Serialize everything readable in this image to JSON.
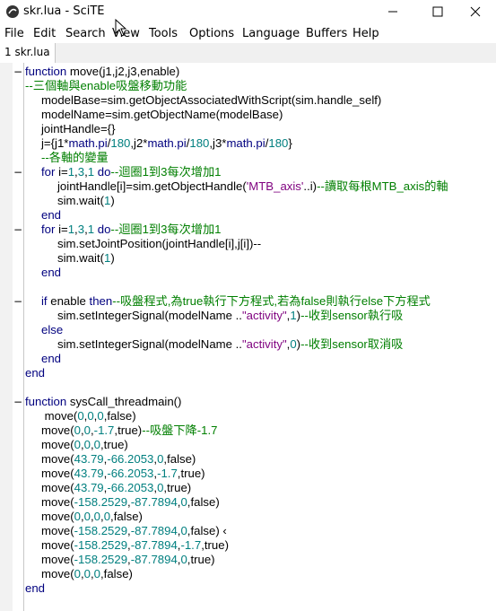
{
  "window": {
    "title": "skr.lua - SciTE"
  },
  "menu": [
    "File",
    "Edit",
    "Search",
    "View",
    "Tools",
    "Options",
    "Language",
    "Buffers",
    "Help"
  ],
  "tab": {
    "label": "1 skr.lua"
  },
  "code_lines": [
    {
      "fold": "−",
      "indent": 0,
      "t": [
        [
          "kw",
          "function "
        ],
        [
          "id",
          "move(j1,j2,j3,enable)"
        ]
      ]
    },
    {
      "fold": "",
      "indent": 0,
      "t": [
        [
          "cm",
          "--三個軸與enable吸盤移動功能"
        ]
      ]
    },
    {
      "fold": "",
      "indent": 1,
      "t": [
        [
          "id",
          "modelBase=sim.getObjectAssociatedWithScript(sim.handle_self)"
        ]
      ]
    },
    {
      "fold": "",
      "indent": 1,
      "t": [
        [
          "id",
          "modelName=sim.getObjectName(modelBase)"
        ]
      ]
    },
    {
      "fold": "",
      "indent": 1,
      "t": [
        [
          "id",
          "jointHandle={}"
        ]
      ]
    },
    {
      "fold": "",
      "indent": 1,
      "t": [
        [
          "id",
          "j={j1*"
        ],
        [
          "kw",
          "math.pi"
        ],
        [
          "id",
          "/"
        ],
        [
          "num",
          "180"
        ],
        [
          "id",
          ",j2*"
        ],
        [
          "kw",
          "math.pi"
        ],
        [
          "id",
          "/"
        ],
        [
          "num",
          "180"
        ],
        [
          "id",
          ",j3*"
        ],
        [
          "kw",
          "math.pi"
        ],
        [
          "id",
          "/"
        ],
        [
          "num",
          "180"
        ],
        [
          "id",
          "}"
        ]
      ]
    },
    {
      "fold": "",
      "indent": 1,
      "t": [
        [
          "cm",
          "--各軸的變量"
        ]
      ]
    },
    {
      "fold": "−",
      "indent": 1,
      "t": [
        [
          "kw",
          "for "
        ],
        [
          "id",
          "i="
        ],
        [
          "num",
          "1"
        ],
        [
          "id",
          ","
        ],
        [
          "num",
          "3"
        ],
        [
          "id",
          ","
        ],
        [
          "num",
          "1"
        ],
        [
          "kw",
          " do"
        ],
        [
          "cm",
          "--迴圈1到3每次增加1"
        ]
      ]
    },
    {
      "fold": "",
      "indent": 2,
      "t": [
        [
          "id",
          "jointHandle[i]=sim.getObjectHandle("
        ],
        [
          "str",
          "'MTB_axis'"
        ],
        [
          "id",
          "..i)"
        ],
        [
          "cm",
          "--讀取每根MTB_axis的軸"
        ]
      ]
    },
    {
      "fold": "",
      "indent": 2,
      "t": [
        [
          "id",
          "sim.wait("
        ],
        [
          "num",
          "1"
        ],
        [
          "id",
          ")"
        ]
      ]
    },
    {
      "fold": "",
      "indent": 1,
      "t": [
        [
          "kw",
          "end"
        ]
      ]
    },
    {
      "fold": "−",
      "indent": 1,
      "t": [
        [
          "kw",
          "for "
        ],
        [
          "id",
          "i="
        ],
        [
          "num",
          "1"
        ],
        [
          "id",
          ","
        ],
        [
          "num",
          "3"
        ],
        [
          "id",
          ","
        ],
        [
          "num",
          "1"
        ],
        [
          "kw",
          " do"
        ],
        [
          "cm",
          "--迴圈1到3每次增加1"
        ]
      ]
    },
    {
      "fold": "",
      "indent": 2,
      "t": [
        [
          "id",
          "sim.setJointPosition(jointHandle[i],j[i])--"
        ]
      ]
    },
    {
      "fold": "",
      "indent": 2,
      "t": [
        [
          "id",
          "sim.wait("
        ],
        [
          "num",
          "1"
        ],
        [
          "id",
          ")"
        ]
      ]
    },
    {
      "fold": "",
      "indent": 1,
      "t": [
        [
          "kw",
          "end"
        ]
      ]
    },
    {
      "fold": "",
      "indent": 0,
      "t": []
    },
    {
      "fold": "−",
      "indent": 1,
      "t": [
        [
          "kw",
          "if "
        ],
        [
          "id",
          "enable "
        ],
        [
          "kw",
          "then"
        ],
        [
          "cm",
          "--吸盤程式,為true執行下方程式,若為false則執行else下方程式"
        ]
      ]
    },
    {
      "fold": "",
      "indent": 2,
      "t": [
        [
          "id",
          "sim.setIntegerSignal(modelName .."
        ],
        [
          "str",
          "\"activity\""
        ],
        [
          "id",
          ","
        ],
        [
          "num",
          "1"
        ],
        [
          "id",
          ")"
        ],
        [
          "cm",
          "--收到sensor執行吸"
        ]
      ]
    },
    {
      "fold": "",
      "indent": 1,
      "t": [
        [
          "kw",
          "else"
        ]
      ]
    },
    {
      "fold": "",
      "indent": 2,
      "t": [
        [
          "id",
          "sim.setIntegerSignal(modelName .."
        ],
        [
          "str",
          "\"activity\""
        ],
        [
          "id",
          ","
        ],
        [
          "num",
          "0"
        ],
        [
          "id",
          ")"
        ],
        [
          "cm",
          "--收到sensor取消吸"
        ]
      ]
    },
    {
      "fold": "",
      "indent": 1,
      "t": [
        [
          "kw",
          "end"
        ]
      ]
    },
    {
      "fold": "",
      "indent": 0,
      "t": [
        [
          "kw",
          "end"
        ]
      ]
    },
    {
      "fold": "",
      "indent": 0,
      "t": []
    },
    {
      "fold": "−",
      "indent": 0,
      "t": [
        [
          "kw",
          "function "
        ],
        [
          "id",
          "sysCall_threadmain()"
        ]
      ]
    },
    {
      "fold": "",
      "indent": 1,
      "t": [
        [
          "id",
          " move("
        ],
        [
          "num",
          "0"
        ],
        [
          "id",
          ","
        ],
        [
          "num",
          "0"
        ],
        [
          "id",
          ","
        ],
        [
          "num",
          "0"
        ],
        [
          "id",
          ",false)"
        ]
      ]
    },
    {
      "fold": "",
      "indent": 1,
      "t": [
        [
          "id",
          "move("
        ],
        [
          "num",
          "0"
        ],
        [
          "id",
          ","
        ],
        [
          "num",
          "0"
        ],
        [
          "id",
          ","
        ],
        [
          "num",
          "-1.7"
        ],
        [
          "id",
          ",true)"
        ],
        [
          "cm",
          "--吸盤下降-1.7"
        ]
      ]
    },
    {
      "fold": "",
      "indent": 1,
      "t": [
        [
          "id",
          "move("
        ],
        [
          "num",
          "0"
        ],
        [
          "id",
          ","
        ],
        [
          "num",
          "0"
        ],
        [
          "id",
          ","
        ],
        [
          "num",
          "0"
        ],
        [
          "id",
          ",true)"
        ]
      ]
    },
    {
      "fold": "",
      "indent": 1,
      "t": [
        [
          "id",
          "move("
        ],
        [
          "num",
          "43.79"
        ],
        [
          "id",
          ","
        ],
        [
          "num",
          "-66.2053"
        ],
        [
          "id",
          ","
        ],
        [
          "num",
          "0"
        ],
        [
          "id",
          ",false)"
        ]
      ]
    },
    {
      "fold": "",
      "indent": 1,
      "t": [
        [
          "id",
          "move("
        ],
        [
          "num",
          "43.79"
        ],
        [
          "id",
          ","
        ],
        [
          "num",
          "-66.2053"
        ],
        [
          "id",
          ","
        ],
        [
          "num",
          "-1.7"
        ],
        [
          "id",
          ",true)"
        ]
      ]
    },
    {
      "fold": "",
      "indent": 1,
      "t": [
        [
          "id",
          "move("
        ],
        [
          "num",
          "43.79"
        ],
        [
          "id",
          ","
        ],
        [
          "num",
          "-66.2053"
        ],
        [
          "id",
          ","
        ],
        [
          "num",
          "0"
        ],
        [
          "id",
          ",true)"
        ]
      ]
    },
    {
      "fold": "",
      "indent": 1,
      "t": [
        [
          "id",
          "move("
        ],
        [
          "num",
          "-158.2529"
        ],
        [
          "id",
          ","
        ],
        [
          "num",
          "-87.7894"
        ],
        [
          "id",
          ","
        ],
        [
          "num",
          "0"
        ],
        [
          "id",
          ",false)"
        ]
      ]
    },
    {
      "fold": "",
      "indent": 1,
      "t": [
        [
          "id",
          "move("
        ],
        [
          "num",
          "0"
        ],
        [
          "id",
          ","
        ],
        [
          "num",
          "0"
        ],
        [
          "id",
          ","
        ],
        [
          "num",
          "0"
        ],
        [
          "id",
          ","
        ],
        [
          "num",
          "0"
        ],
        [
          "id",
          ",false)"
        ]
      ]
    },
    {
      "fold": "",
      "indent": 1,
      "t": [
        [
          "id",
          "move("
        ],
        [
          "num",
          "-158.2529"
        ],
        [
          "id",
          ","
        ],
        [
          "num",
          "-87.7894"
        ],
        [
          "id",
          ","
        ],
        [
          "num",
          "0"
        ],
        [
          "id",
          ",false)"
        ],
        [
          "id",
          " ‹"
        ]
      ]
    },
    {
      "fold": "",
      "indent": 1,
      "t": [
        [
          "id",
          "move("
        ],
        [
          "num",
          "-158.2529"
        ],
        [
          "id",
          ","
        ],
        [
          "num",
          "-87.7894"
        ],
        [
          "id",
          ","
        ],
        [
          "num",
          "-1.7"
        ],
        [
          "id",
          ",true)"
        ]
      ]
    },
    {
      "fold": "",
      "indent": 1,
      "t": [
        [
          "id",
          "move("
        ],
        [
          "num",
          "-158.2529"
        ],
        [
          "id",
          ","
        ],
        [
          "num",
          "-87.7894"
        ],
        [
          "id",
          ","
        ],
        [
          "num",
          "0"
        ],
        [
          "id",
          ",true)"
        ]
      ]
    },
    {
      "fold": "",
      "indent": 1,
      "t": [
        [
          "id",
          "move("
        ],
        [
          "num",
          "0"
        ],
        [
          "id",
          ","
        ],
        [
          "num",
          "0"
        ],
        [
          "id",
          ","
        ],
        [
          "num",
          "0"
        ],
        [
          "id",
          ",false)"
        ]
      ]
    },
    {
      "fold": "",
      "indent": 0,
      "t": [
        [
          "kw",
          "end"
        ]
      ]
    }
  ],
  "colors": {
    "keyword": "#00007f",
    "comment": "#007f00",
    "number": "#007f7f",
    "string": "#7f007f"
  },
  "icons": [
    "scite-app-icon",
    "minimize-icon",
    "maximize-icon",
    "close-icon",
    "mouse-cursor-icon"
  ]
}
